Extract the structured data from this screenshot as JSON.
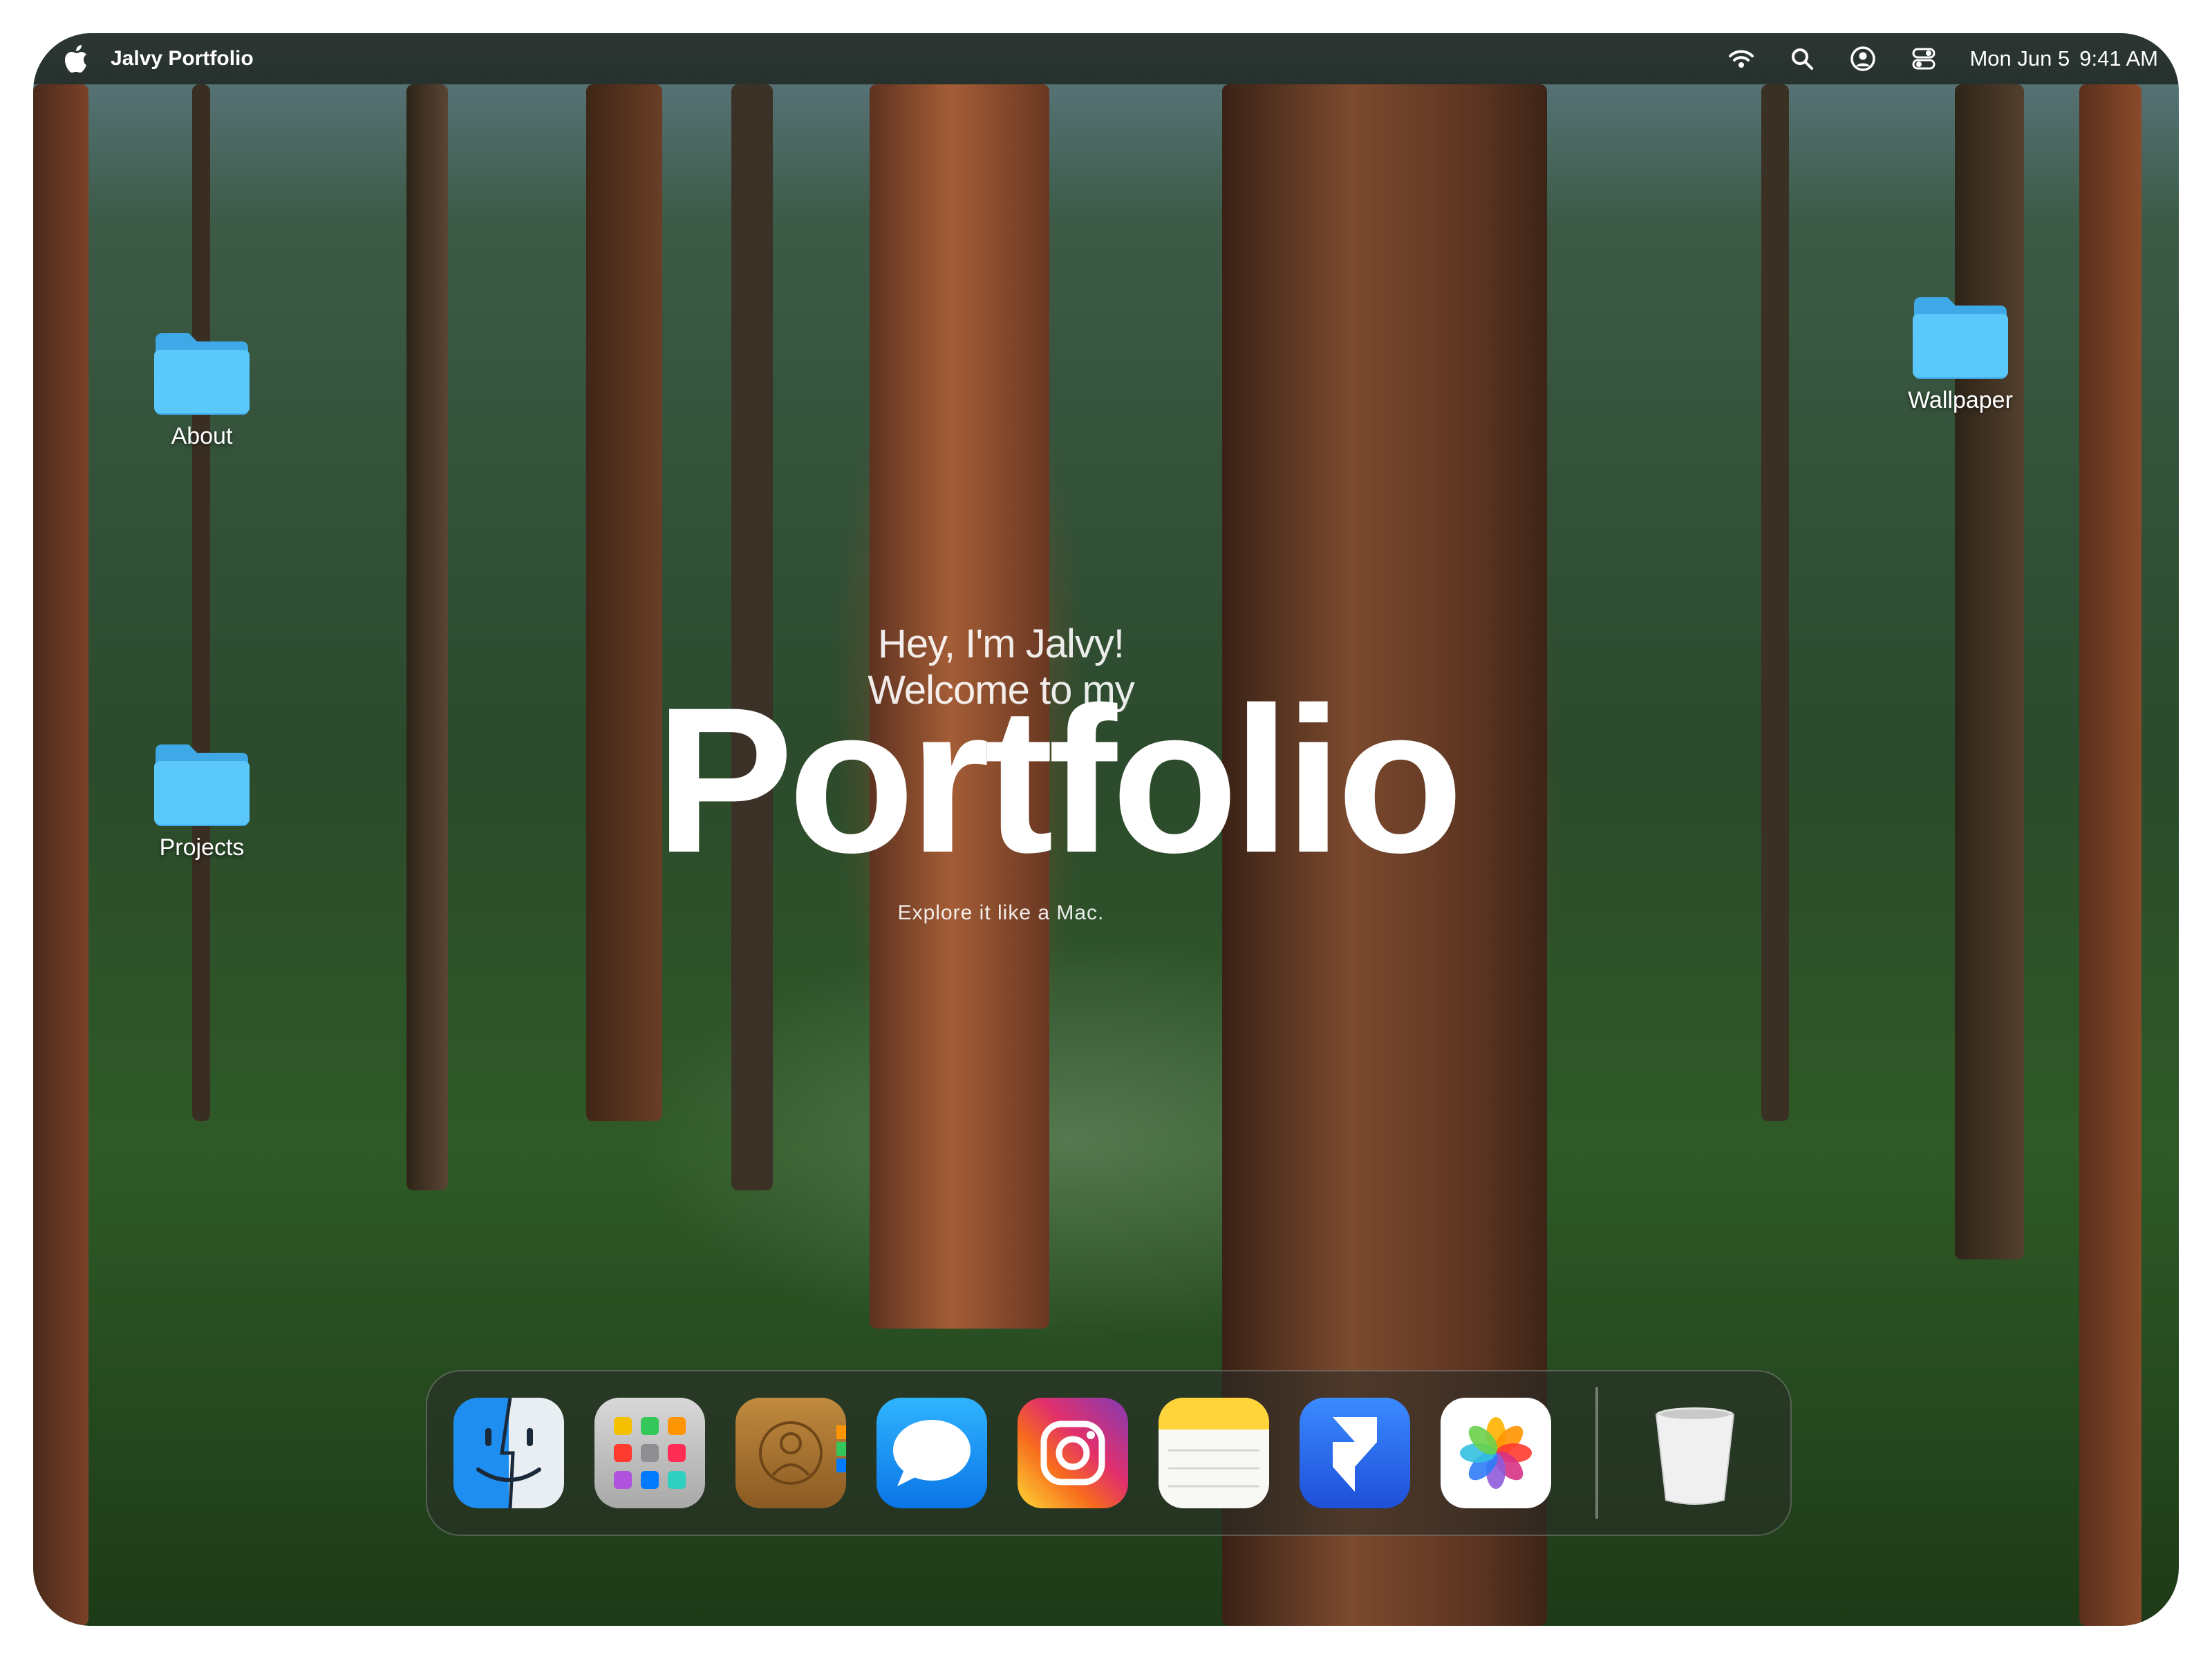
{
  "menubar": {
    "app_title": "Jalvy Portfolio",
    "icons": [
      "apple-logo",
      "wifi-icon",
      "search-icon",
      "user-icon",
      "control-center-icon"
    ],
    "date": "Mon Jun 5",
    "time": "9:41 AM"
  },
  "desktop": {
    "folders": [
      {
        "label": "About"
      },
      {
        "label": "Projects"
      },
      {
        "label": "Wallpaper"
      }
    ],
    "folder_color": "#5ac8fa"
  },
  "hero": {
    "subtitle": "Hey, I'm Jalvy! Welcome to my",
    "title": "Portfolio",
    "tagline": "Explore it like a Mac."
  },
  "dock": {
    "items": [
      {
        "name": "Finder",
        "icon": "finder-icon"
      },
      {
        "name": "Launchpad",
        "icon": "launchpad-icon"
      },
      {
        "name": "Contacts",
        "icon": "contacts-icon"
      },
      {
        "name": "Messages",
        "icon": "messages-icon"
      },
      {
        "name": "Instagram",
        "icon": "instagram-icon"
      },
      {
        "name": "Notes",
        "icon": "notes-icon"
      },
      {
        "name": "Framer",
        "icon": "framer-icon"
      },
      {
        "name": "Photos",
        "icon": "photos-icon"
      },
      {
        "name": "Trash",
        "icon": "trash-icon"
      }
    ]
  }
}
